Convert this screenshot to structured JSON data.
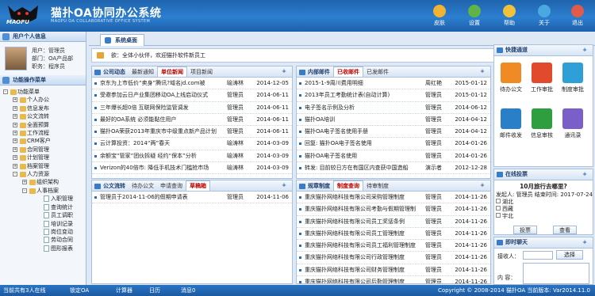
{
  "header": {
    "logo_text": "MAOPU",
    "title": "猫扑OA协同办公系统",
    "subtitle": "MAOPU OA COLLABORATIVE OFFICE SYSTEM",
    "tools": [
      {
        "label": "皮肤",
        "color": "#f2b233"
      },
      {
        "label": "设置",
        "color": "#60b347"
      },
      {
        "label": "帮助",
        "color": "#f0c23b"
      },
      {
        "label": "关于",
        "color": "#4aa8e0"
      },
      {
        "label": "退出",
        "color": "#e05b48"
      }
    ]
  },
  "sidebar": {
    "user_title": "用户个人信息",
    "user_lines": [
      "用户：管理员",
      "部门：OA产品部",
      "职务：程序员"
    ],
    "menu_title": "功能操作菜单",
    "tree": [
      {
        "t": "功能菜单",
        "lvl": 1,
        "toggle": "-"
      },
      {
        "t": "个人办公",
        "lvl": 2,
        "toggle": "+"
      },
      {
        "t": "信息发布",
        "lvl": 2,
        "toggle": "+"
      },
      {
        "t": "公文流转",
        "lvl": 2,
        "toggle": "+"
      },
      {
        "t": "全面预算",
        "lvl": 2,
        "toggle": "+"
      },
      {
        "t": "工作流程",
        "lvl": 2,
        "toggle": "+"
      },
      {
        "t": "CRM客户",
        "lvl": 2,
        "toggle": "+"
      },
      {
        "t": "合同管理",
        "lvl": 2,
        "toggle": "+"
      },
      {
        "t": "计划管理",
        "lvl": 2,
        "toggle": "+"
      },
      {
        "t": "档案管理",
        "lvl": 2,
        "toggle": "+"
      },
      {
        "t": "人力资源",
        "lvl": 2,
        "toggle": "-"
      },
      {
        "t": "组织架构",
        "lvl": 3,
        "toggle": "+"
      },
      {
        "t": "人事档案",
        "lvl": 3,
        "toggle": "-"
      },
      {
        "t": "入职管理",
        "lvl": 4
      },
      {
        "t": "查询统计",
        "lvl": 4
      },
      {
        "t": "员工调职",
        "lvl": 4
      },
      {
        "t": "培训记录",
        "lvl": 4
      },
      {
        "t": "岗位变动",
        "lvl": 4
      },
      {
        "t": "劳动合同",
        "lvl": 4
      },
      {
        "t": "图形报表",
        "lvl": 4
      }
    ]
  },
  "main": {
    "tab": "系统桌面",
    "notice": "欲：全体小伙伴，欢迎猫扑软件新员工",
    "all_button": "全部",
    "p1": {
      "tabs": [
        "公司动态",
        "最新通知",
        "单位新闻",
        "项目新闻"
      ],
      "active": 2,
      "rows": [
        [
          "京东为上市低价“卖身”腾讯?域名jd.com被",
          "喻涛林",
          "2014-12-05"
        ],
        [
          "受邀参加云日产业集团移动OA上线启动仪式",
          "管理员",
          "2014-06-11"
        ],
        [
          "三年爆长超0倍 互联网保险监管调发",
          "管理员",
          "2014-06-11"
        ],
        [
          "最好的OA系统 必须能黏住用户",
          "管理员",
          "2014-06-11"
        ],
        [
          "猫扑OA荣获2013年重庆市中级重点新产品计划",
          "管理员",
          "2014-06-11"
        ],
        [
          "云计算投资：2014“两”春天",
          "喻涛林",
          "2014-03-09"
        ],
        [
          "余额宝“管家”团伙拆疑 经约“保本”分析",
          "喻涛林",
          "2014-03-09"
        ],
        [
          "Verizon的40倍市: 降低手机技术门槛抢市场",
          "喻涛林",
          "2014-03-09"
        ]
      ]
    },
    "p2": {
      "tabs": [
        "内部邮件",
        "已收邮件",
        "已发邮件"
      ],
      "active": 1,
      "rows": [
        [
          "2015-1-9周川费用明细",
          "周红艳",
          "2015-01-12"
        ],
        [
          "2013年员工考勤统计表(自动计算)",
          "管理员",
          "2015-01-12"
        ],
        [
          "电子签名示例及分析",
          "管理员",
          "2014-06-12"
        ],
        [
          "猫扑OA培训",
          "管理员",
          "2014-04-12"
        ],
        [
          "猫扑OA电子签名使用手册",
          "管理员",
          "2014-04-12"
        ],
        [
          "回复: 猫扑OA电子签名使用",
          "管理员",
          "2014-01-26"
        ],
        [
          "猫扑OA电子签名使用",
          "管理员",
          "2014-01-26"
        ],
        [
          "转发: 目前较日方在有国区内查获中国造船",
          "演示者",
          "2012-12-28"
        ]
      ]
    },
    "p3": {
      "tabs": [
        "公文流转",
        "待办公文",
        "申请查询",
        "草稿箱"
      ],
      "active": 3,
      "rows": [
        [
          "管理员于2014-11-06的假期申请表",
          "管理员",
          "2014-11-06"
        ]
      ]
    },
    "p4": {
      "tabs": [
        "规章制度",
        "制度查询",
        "待审制度"
      ],
      "active": 1,
      "rows": [
        [
          "重庆猫扑网络科技有限公司采购管理制度",
          "管理员",
          "2014-11-26"
        ],
        [
          "重庆猫扑网络科技有限公司考勤与假期管理制",
          "管理员",
          "2014-11-26"
        ],
        [
          "重庆猫扑网络科技有限公司员工奖惩条例",
          "管理员",
          "2014-11-26"
        ],
        [
          "重庆猫扑网络科技有限公司员工管理制度",
          "管理员",
          "2014-11-26"
        ],
        [
          "重庆猫扑网络科技有限公司员工福利管理制度",
          "管理员",
          "2014-11-26"
        ],
        [
          "重庆猫扑网络科技有限公司行政管理制度",
          "管理员",
          "2014-11-26"
        ],
        [
          "重庆猫扑网络科技有限公司财务管理制度",
          "管理员",
          "2014-11-26"
        ],
        [
          "重庆猫扑网络科技有限公司后勤管理制度",
          "管理员",
          "2014-11-26"
        ]
      ]
    },
    "quick": {
      "title": "快捷通道",
      "items": [
        {
          "label": "待办公文",
          "color": "#f08a24"
        },
        {
          "label": "工作审批",
          "color": "#e24a2d"
        },
        {
          "label": "制度审批",
          "color": "#2f9fd8"
        },
        {
          "label": "邮件收发",
          "color": "#2a80c8"
        },
        {
          "label": "信息审核",
          "color": "#2e9e3e"
        },
        {
          "label": "通讯录",
          "color": "#7a5fc8"
        }
      ]
    },
    "vote": {
      "title": "在线投票",
      "question": "10月旅行去哪里?",
      "meta": "发起人: 管理员 结束时间: 2017-07-24",
      "options": [
        "湖北",
        "西藏",
        "宇北"
      ],
      "vote_btn": "投票",
      "view_btn": "查看"
    },
    "chat": {
      "title": "即时聊天",
      "recv_label": "接收人：",
      "select_btn": "选择",
      "content_label": "内 容："
    }
  },
  "status": {
    "online": "当前共有3人在线",
    "lock": "锁定OA",
    "calc": "计算器",
    "cal": "日历",
    "msg": "消息0",
    "copyright": "Copyright © 2008-2014 猫扑OA 当前版本: Var2014.11.0"
  }
}
